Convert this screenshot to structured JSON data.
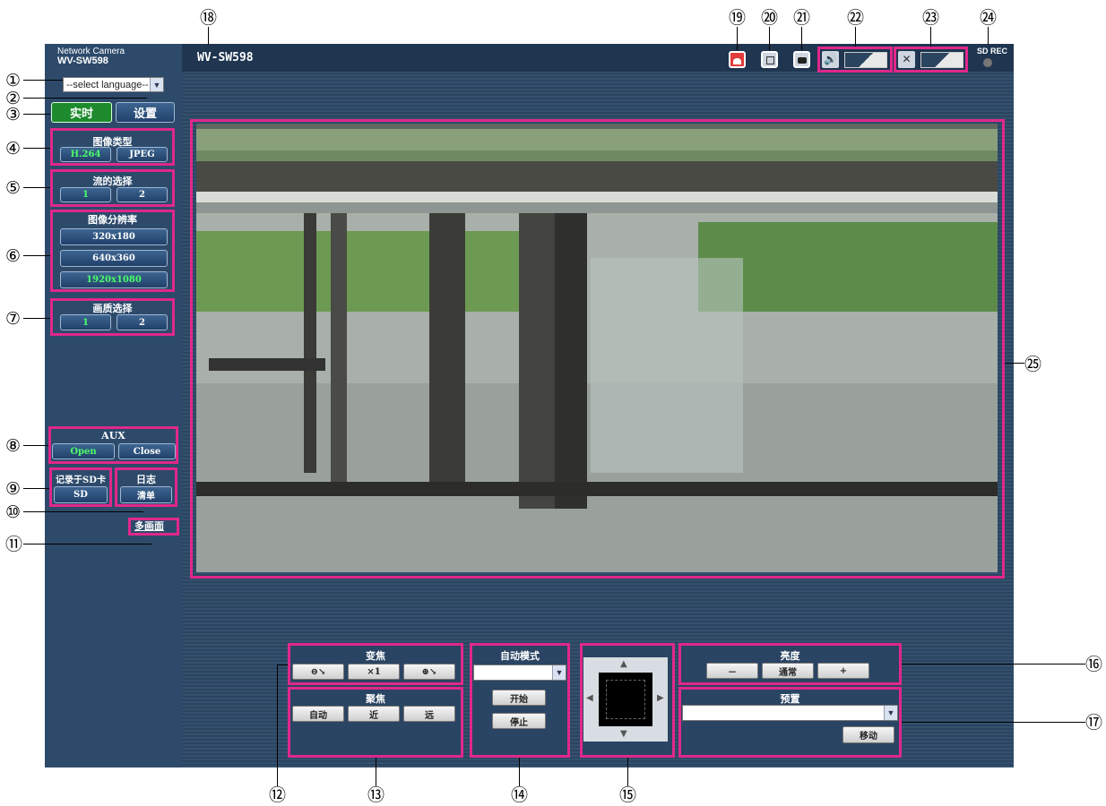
{
  "camera": {
    "brand": "Network Camera",
    "model": "WV-SW598",
    "title": "WV-SW598",
    "sd_rec": "SD REC"
  },
  "language_select": {
    "value": "--select language--"
  },
  "tabs": {
    "live": "实时",
    "setup": "设置"
  },
  "image_type": {
    "title": "图像类型",
    "h264": "H.264",
    "jpeg": "JPEG"
  },
  "stream": {
    "title": "流的选择",
    "one": "1",
    "two": "2"
  },
  "resolution": {
    "title": "图像分辨率",
    "options": [
      "320x180",
      "640x360",
      "1920x1080"
    ]
  },
  "quality": {
    "title": "画质选择",
    "one": "1",
    "two": "2"
  },
  "aux": {
    "title": "AUX",
    "open": "Open",
    "close": "Close"
  },
  "sd_record": {
    "title": "记录于SD卡",
    "button": "SD"
  },
  "log": {
    "title": "日志",
    "button": "清单"
  },
  "multiscreen": {
    "label": "多画面"
  },
  "zoom": {
    "title": "变焦",
    "reset": "×1"
  },
  "focus": {
    "title": "聚焦",
    "auto": "自动",
    "near": "近",
    "far": "远"
  },
  "auto_mode": {
    "title": "自动模式",
    "start": "开始",
    "stop": "停止"
  },
  "brightness": {
    "title": "亮度",
    "minus": "－",
    "normal": "通常",
    "plus": "+"
  },
  "preset": {
    "title": "预置",
    "go": "移动"
  },
  "callouts": {
    "c1": "①",
    "c2": "②",
    "c3": "③",
    "c4": "④",
    "c5": "⑤",
    "c6": "⑥",
    "c7": "⑦",
    "c8": "⑧",
    "c9": "⑨",
    "c10": "⑩",
    "c11": "⑪",
    "c12": "⑫",
    "c13": "⑬",
    "c14": "⑭",
    "c15": "⑮",
    "c16": "⑯",
    "c17": "⑰",
    "c18": "⑱",
    "c19": "⑲",
    "c20": "⑳",
    "c21": "㉑",
    "c22": "㉒",
    "c23": "㉓",
    "c24": "㉔",
    "c25": "㉕"
  },
  "colors": {
    "highlight": "#e0288a",
    "sidebar": "#2d4a6b",
    "live_green": "#1d8a2d"
  }
}
